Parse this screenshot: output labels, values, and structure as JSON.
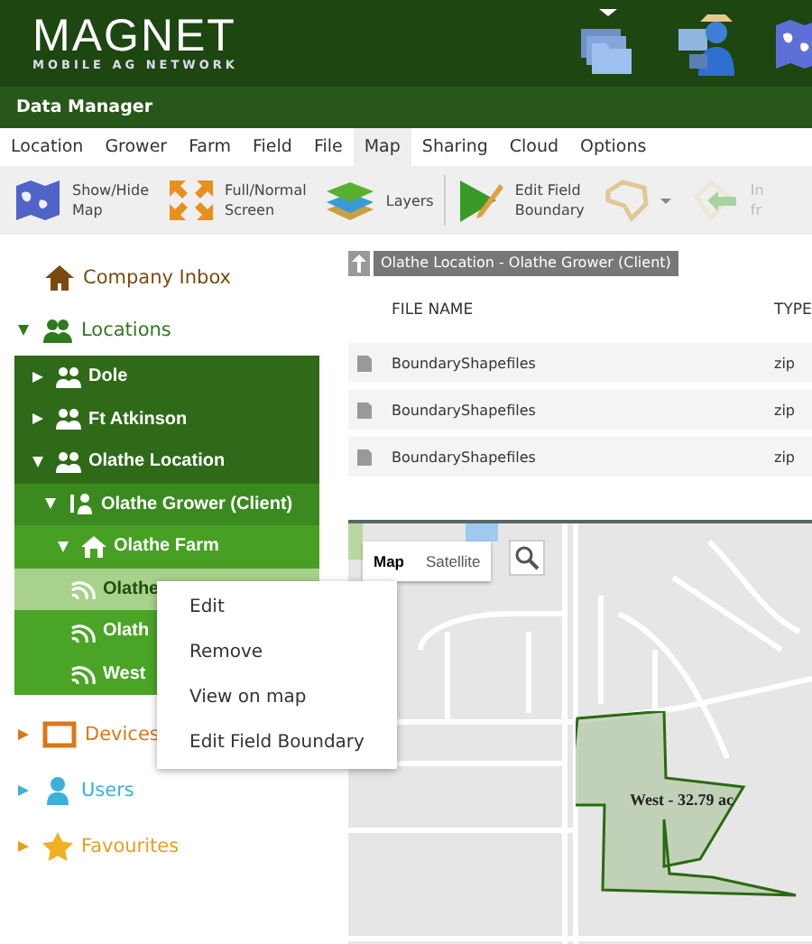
{
  "header": {
    "logo": "MAGNET",
    "tagline": "MOBILE AG NETWORK"
  },
  "app_bar": {
    "title": "Data Manager"
  },
  "tabs": [
    {
      "label": "Location",
      "selected": false
    },
    {
      "label": "Grower",
      "selected": false
    },
    {
      "label": "Farm",
      "selected": false
    },
    {
      "label": "Field",
      "selected": false
    },
    {
      "label": "File",
      "selected": false
    },
    {
      "label": "Map",
      "selected": true
    },
    {
      "label": "Sharing",
      "selected": false
    },
    {
      "label": "Cloud",
      "selected": false
    },
    {
      "label": "Options",
      "selected": false
    }
  ],
  "toolbar": [
    {
      "kind": "map",
      "label": [
        "Show/Hide",
        "Map"
      ],
      "disabled": false
    },
    {
      "kind": "fullscreen",
      "label": [
        "Full/Normal",
        "Screen"
      ],
      "disabled": false
    },
    {
      "kind": "layers",
      "label": [
        "Layers"
      ],
      "disabled": false
    },
    {
      "kind": "edit",
      "label": [
        "Edit Field",
        "Boundary"
      ],
      "disabled": false
    },
    {
      "kind": "shape",
      "disabled": false
    },
    {
      "kind": "import",
      "label": [
        "In",
        "fr"
      ],
      "disabled": true
    }
  ],
  "sidebar": [
    {
      "kind": "inbox",
      "label": "Company Inbox",
      "color": "#7a4a10"
    },
    {
      "kind": "locations",
      "label": "Locations",
      "color": "#2f7a1c",
      "expanded": true,
      "children": [
        {
          "kind": "location",
          "label": "Dole",
          "expanded": false
        },
        {
          "kind": "location",
          "label": "Ft Atkinson",
          "expanded": false
        },
        {
          "kind": "location",
          "label": "Olathe Location",
          "expanded": true,
          "children": [
            {
              "kind": "grower",
              "label": "Olathe Grower (Client)",
              "expanded": true,
              "children": [
                {
                  "kind": "farm",
                  "label": "Olathe Farm",
                  "expanded": true,
                  "children": [
                    {
                      "kind": "field",
                      "label": "Olathe",
                      "selected": true
                    },
                    {
                      "kind": "field",
                      "label": "Olath",
                      "selected": false
                    },
                    {
                      "kind": "field",
                      "label": "West",
                      "selected": false
                    }
                  ]
                }
              ]
            }
          ]
        }
      ]
    },
    {
      "kind": "devices",
      "label": "Devices",
      "color": "#d9781a",
      "expanded": false
    },
    {
      "kind": "users",
      "label": "Users",
      "color": "#3bb0d8",
      "expanded": false
    },
    {
      "kind": "favourites",
      "label": "Favourites",
      "color": "#e8a020",
      "expanded": false
    }
  ],
  "context_menu": [
    "Edit",
    "Remove",
    "View on map",
    "Edit Field Boundary"
  ],
  "breadcrumb": "Olathe Location - Olathe Grower (Client)",
  "table": {
    "columns": [
      "FILE NAME",
      "TYPE"
    ],
    "rows": [
      [
        "BoundaryShapefiles",
        "zip"
      ],
      [
        "BoundaryShapefiles",
        "zip"
      ],
      [
        "BoundaryShapefiles",
        "zip"
      ]
    ]
  },
  "map": {
    "types": [
      {
        "label": "Map",
        "selected": true
      },
      {
        "label": "Satellite",
        "selected": false
      }
    ],
    "field_label": "West - 32.79 ac"
  }
}
